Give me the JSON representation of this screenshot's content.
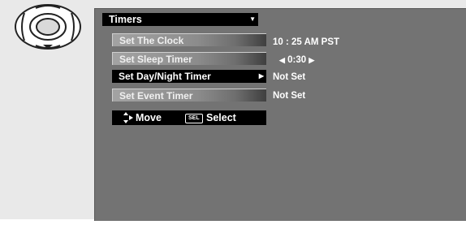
{
  "menu": {
    "title": "Timers",
    "items": [
      {
        "label": "Set The Clock",
        "value": "10 : 25 AM PST"
      },
      {
        "label": "Set Sleep Timer",
        "value": "0:30"
      },
      {
        "label": "Set Day/Night Timer",
        "value": "Not Set"
      },
      {
        "label": "Set Event Timer",
        "value": "Not Set"
      }
    ],
    "selected_index": 2
  },
  "help": {
    "move_label": "Move",
    "sel_badge": "SEL",
    "select_label": "Select"
  },
  "icons": {
    "remote": "dpad-icon",
    "title_dropdown": "triangle-down-icon",
    "submenu": "triangle-right-icon",
    "decrease": "triangle-left-icon",
    "increase": "triangle-right-icon",
    "move": "up-down-arrow-icon"
  },
  "colors": {
    "screen_bg": "#737373",
    "menu_bg": "#000000",
    "text": "#ffffff"
  }
}
